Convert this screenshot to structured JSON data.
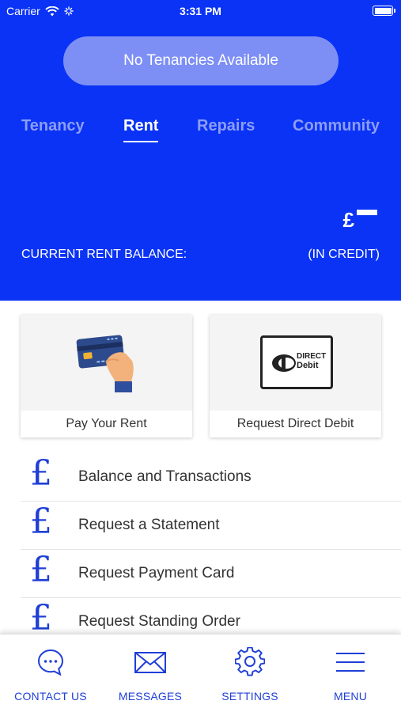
{
  "status_bar": {
    "carrier": "Carrier",
    "time": "3:31 PM"
  },
  "header": {
    "tenancy_pill": "No Tenancies Available",
    "tabs": [
      {
        "label": "Tenancy",
        "active": false
      },
      {
        "label": "Rent",
        "active": true
      },
      {
        "label": "Repairs",
        "active": false
      },
      {
        "label": "Community",
        "active": false
      }
    ],
    "currency_symbol": "£",
    "balance_label": "CURRENT RENT BALANCE:",
    "balance_status": "(IN CREDIT)"
  },
  "cards": [
    {
      "label": "Pay Your Rent",
      "icon": "hand-card-icon"
    },
    {
      "label": "Request Direct Debit",
      "icon": "direct-debit-logo",
      "logo_text": [
        "DIRECT",
        "Debit"
      ]
    }
  ],
  "list": {
    "icon_glyph": "£",
    "items": [
      {
        "label": "Balance and Transactions"
      },
      {
        "label": "Request a Statement"
      },
      {
        "label": "Request Payment Card"
      },
      {
        "label": "Request Standing Order"
      }
    ]
  },
  "bottom_nav": [
    {
      "label": "CONTACT US",
      "icon": "chat-bubble-icon"
    },
    {
      "label": "MESSAGES",
      "icon": "envelope-icon"
    },
    {
      "label": "SETTINGS",
      "icon": "gear-icon"
    },
    {
      "label": "MENU",
      "icon": "hamburger-icon"
    }
  ],
  "colors": {
    "primary": "#0a33f5",
    "pill": "#7d8ff5",
    "tab_inactive": "#8d9df8",
    "accent": "#1f3fd6"
  }
}
